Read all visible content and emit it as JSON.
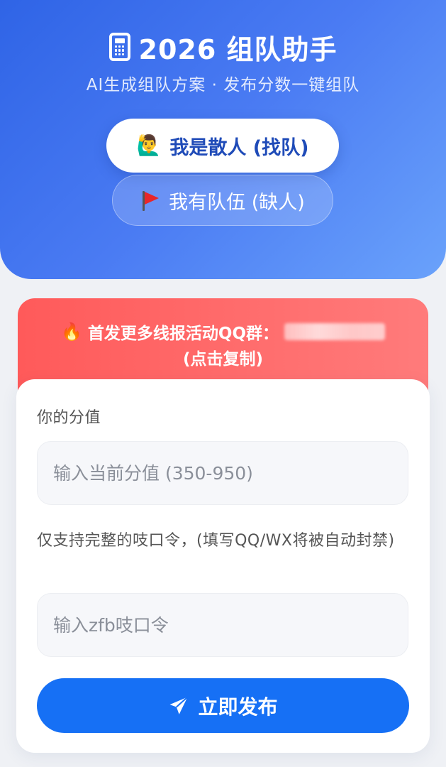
{
  "header": {
    "title_icon": "calculator-icon",
    "title": "2026 组队助手",
    "subtitle": "AI生成组队方案 · 发布分数一键组队"
  },
  "roles": {
    "solo": {
      "icon": "person-raising-hand-emoji",
      "emoji": "🙋‍♂️",
      "label": "我是散人 (找队)",
      "selected": true
    },
    "team": {
      "icon": "red-flag-icon",
      "label": "我有队伍 (缺人)",
      "selected": false
    }
  },
  "notice": {
    "icon": "fire-emoji",
    "emoji": "🔥",
    "text": "首发更多线报活动QQ群：",
    "copy_hint": "(点击复制)"
  },
  "form": {
    "score_label": "你的分值",
    "score_placeholder": "输入当前分值 (350-950)",
    "code_label": "仅支持完整的吱口令，(填写QQ/WX将被自动封禁)",
    "code_placeholder": "输入zfb吱口令",
    "submit_icon": "send-icon",
    "submit_label": "立即发布"
  },
  "colors": {
    "hero_gradient_start": "#2f64e6",
    "hero_gradient_end": "#6aa2fb",
    "notice_red": "#ff5a5a",
    "primary_blue": "#1670f5",
    "role_primary_text": "#1f4bb8"
  }
}
